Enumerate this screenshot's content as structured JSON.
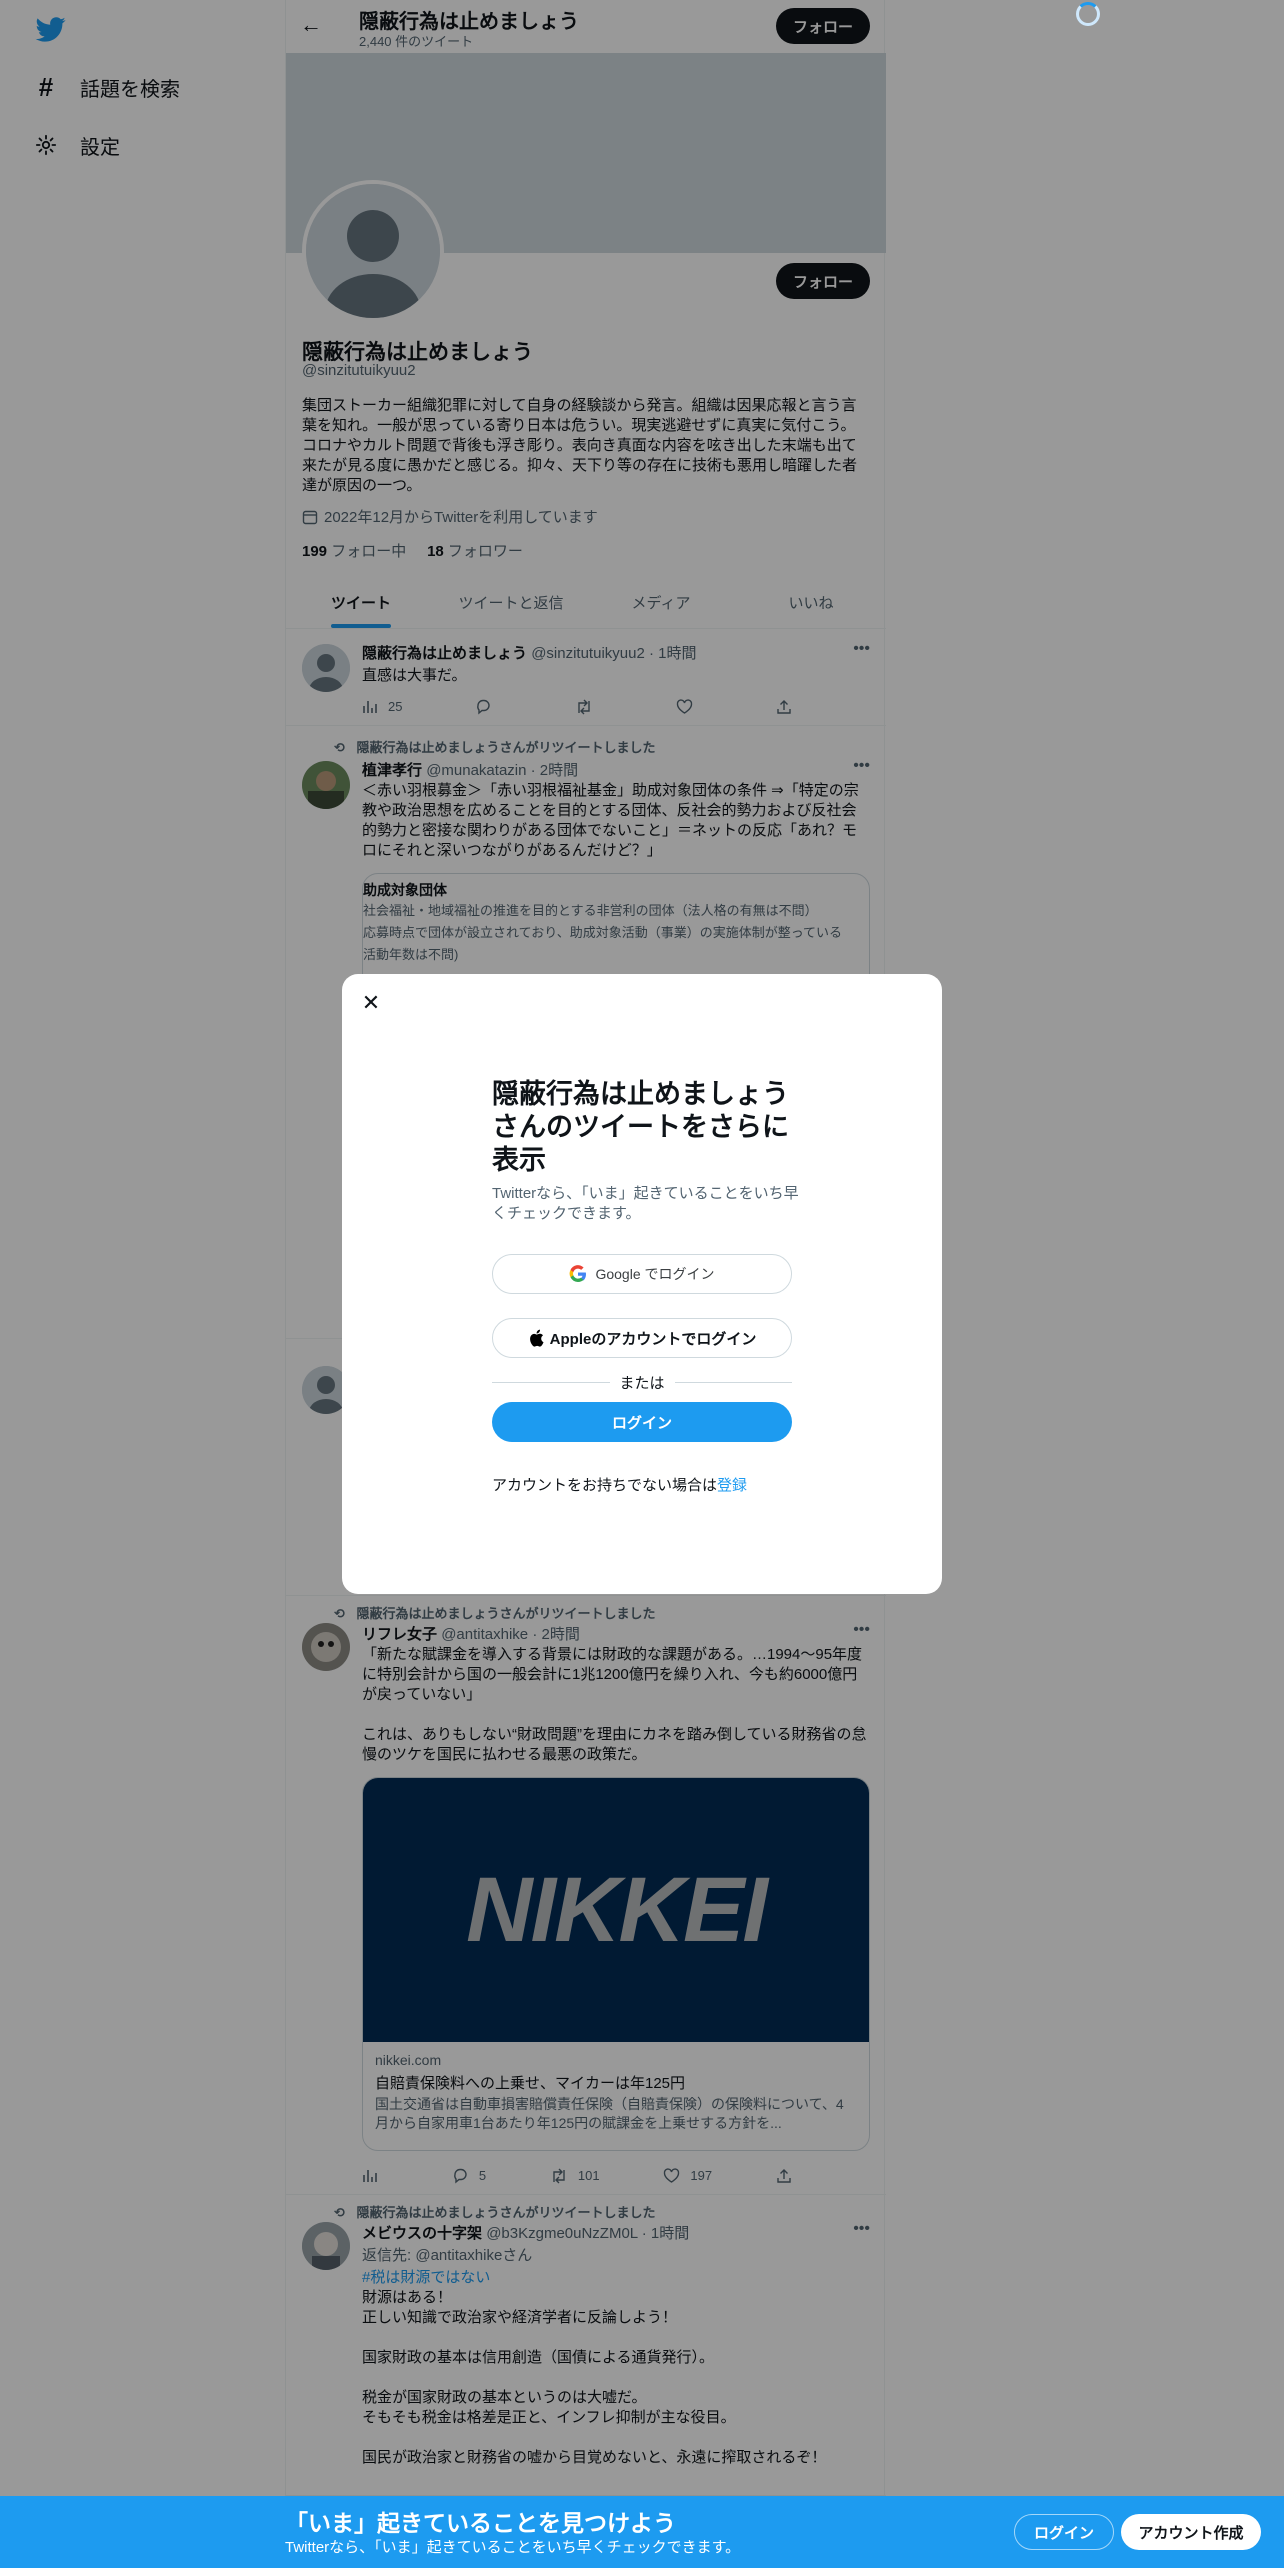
{
  "nav": {
    "items": [
      {
        "label": "話題を検索",
        "icon": "hashtag-icon"
      },
      {
        "label": "設定",
        "icon": "gear-icon"
      }
    ]
  },
  "header": {
    "title": "隠蔽行為は止めましょう",
    "tweet_count": "2,440 件のツイート",
    "follow_label": "フォロー"
  },
  "profile": {
    "name": "隠蔽行為は止めましょう",
    "handle": "@sinzitutuikyuu2",
    "bio": "集団ストーカー組織犯罪に対して自身の経験談から発言。組織は因果応報と言う言葉を知れ。一般が思っている寄り日本は危うい。現実逃避せずに真実に気付こう。コロナやカルト問題で背後も浮き彫り。表向き真面な内容を呟き出した末端も出て来たが見る度に愚かだと感じる。抑々、天下り等の存在に技術も悪用し暗躍した者達が原因の一つ。",
    "joined": "2022年12月からTwitterを利用しています",
    "following_count": "199",
    "following_label": "フォロー中",
    "followers_count": "18",
    "followers_label": "フォロワー",
    "follow_label": "フォロー"
  },
  "tabs": [
    "ツイート",
    "ツイートと返信",
    "メディア",
    "いいね"
  ],
  "tweets": [
    {
      "name": "隠蔽行為は止めましょう",
      "handle": "@sinzitutuikyuu2",
      "time": "· 1時間",
      "text": "直感は大事だ。",
      "views": "25"
    },
    {
      "retweet_by": "隠蔽行為は止めましょうさんがリツイートしました",
      "name": "植津孝行",
      "handle": "@munakatazin",
      "time": "· 2時間",
      "text": "＜赤い羽根募金＞「赤い羽根福祉基金」助成対象団体の条件 ⇒「特定の宗教や政治思想を広めることを目的とする団体、反社会的勢力および反社会的勢力と密接な関わりがある団体でないこと」＝ネットの反応「あれ？モロにそれと深いつながりがあるんだけど？」",
      "card_title": "助成対象団体",
      "card_lines": [
        "社会福祉・地域福祉の推進を目的とする非営利の団体（法人格の有無は不問）",
        "応募時点で団体が設立されており、助成対象活動（事業）の実施体制が整っている",
        "活動年数は不問)"
      ]
    },
    {
      "retweet_by": "隠蔽行為は止めましょうさんがリツイートしました",
      "name": "リフレ女子",
      "handle": "@antitaxhike",
      "time": "· 2時間",
      "text": "「新たな賦課金を導入する背景には財政的な課題がある。…1994～95年度に特別会計から国の一般会計に1兆1200億円を繰り入れ、今も約6000億円が戻っていない」\n\nこれは、ありもしない“財政問題”を理由にカネを踏み倒している財務省の怠慢のツケを国民に払わせる最悪の政策だ。",
      "card_logo": "NIKKEI",
      "card_domain": "nikkei.com",
      "card_title": "自賠責保険料への上乗せ、マイカーは年125円",
      "card_desc": "国土交通省は自動車損害賠償責任保険（自賠責保険）の保険料について、4月から自家用車1台あたり年125円の賦課金を上乗せする方針を...",
      "replies": "5",
      "retweets": "101",
      "likes": "197"
    },
    {
      "retweet_by": "隠蔽行為は止めましょうさんがリツイートしました",
      "name": "メビウスの十字架",
      "handle": "@b3Kzgme0uNzZM0L",
      "time": "· 1時間",
      "reply_prefix": "返信先: ",
      "reply_to": "@antitaxhike",
      "reply_suffix": "さん",
      "hashtag": "#税は財源ではない",
      "text": "財源はある！\n正しい知識で政治家や経済学者に反論しよう！\n\n国家財政の基本は信用創造（国債による通貨発行）。\n\n税金が国家財政の基本というのは大嘘だ。\nそもそも税金は格差是正と、インフレ抑制が主な役目。\n\n国民が政治家と財務省の嘘から目覚めないと、永遠に搾取されるぞ！"
    }
  ],
  "modal": {
    "title": "隠蔽行為は止めましょうさんのツイートをさらに表示",
    "desc": "Twitterなら、「いま」起きていることをいち早くチェックできます。",
    "google_label": "Google でログイン",
    "apple_label": "Appleのアカウントでログイン",
    "or_label": "または",
    "login_label": "ログイン",
    "signup_prefix": "アカウントをお持ちでない場合は",
    "signup_link": "登録"
  },
  "bottom_bar": {
    "title": "「いま」起きていることを見つけよう",
    "subtitle": "Twitterなら、「いま」起きていることをいち早くチェックできます。",
    "login_label": "ログイン",
    "signup_label": "アカウント作成"
  },
  "colors": {
    "accent": "#1d9bf0",
    "overlay": "rgba(0,0,0,0.4)",
    "nikkei_bg": "#032c55"
  }
}
